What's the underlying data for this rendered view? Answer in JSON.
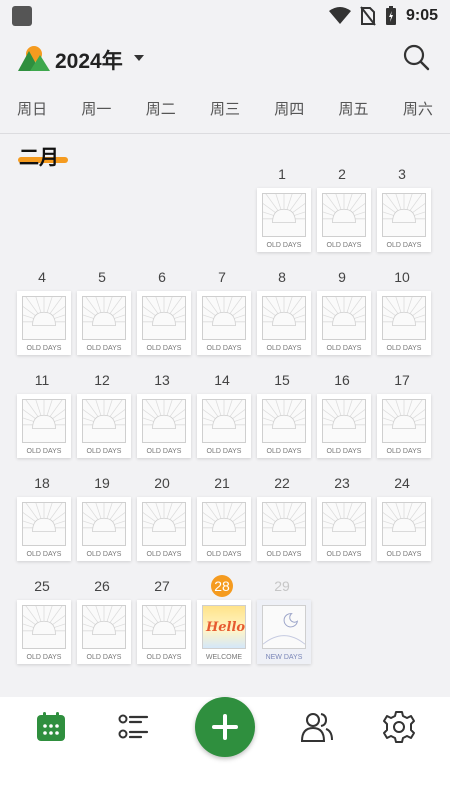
{
  "statusbar": {
    "time": "9:05"
  },
  "header": {
    "year": "2024年"
  },
  "weekdays": [
    "周日",
    "周一",
    "周二",
    "周三",
    "周四",
    "周五",
    "周六"
  ],
  "month_label": "二月",
  "calendar": {
    "today": "28",
    "future_day": "29",
    "stamp_label_old": "OLD DAYS",
    "stamp_label_today": "WELCOME",
    "stamp_label_new": "NEW DAYS",
    "today_stamp_text": "Hello",
    "days": [
      "1",
      "2",
      "3",
      "4",
      "5",
      "6",
      "7",
      "8",
      "9",
      "10",
      "11",
      "12",
      "13",
      "14",
      "15",
      "16",
      "17",
      "18",
      "19",
      "20",
      "21",
      "22",
      "23",
      "24",
      "25",
      "26",
      "27"
    ]
  },
  "colors": {
    "accent": "#2f8f3e",
    "today": "#f59b1f"
  },
  "bottom_nav": [
    "calendar-icon",
    "list-icon",
    "add-icon",
    "people-icon",
    "gear-icon"
  ]
}
